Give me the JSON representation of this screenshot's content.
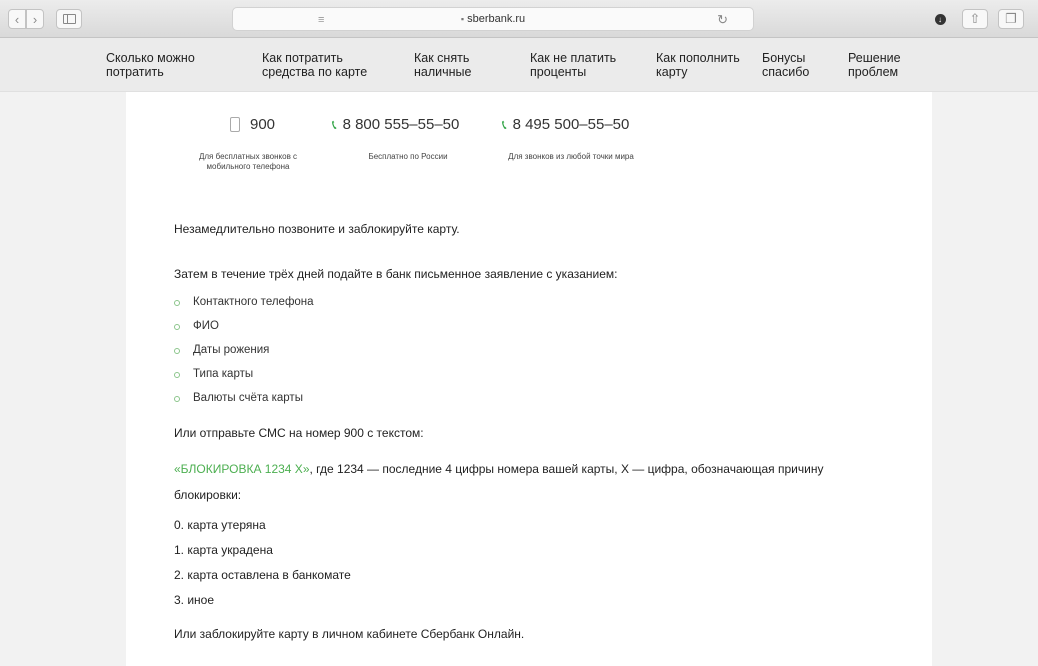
{
  "browser": {
    "url": "sberbank.ru",
    "back_icon": "chevron-left-icon",
    "forward_icon": "chevron-right-icon",
    "sidebar_icon": "sidebar-icon",
    "reader_icon": "reader-lines-icon",
    "lock_icon": "lock-icon",
    "reload_icon": "reload-icon",
    "download_icon": "download-icon",
    "share_icon": "share-icon",
    "tabs_icon": "tabs-icon"
  },
  "nav": {
    "items": [
      {
        "label": "Сколько можно\nпотратить"
      },
      {
        "label": "Как потратить\nсредства по карте"
      },
      {
        "label": "Как снять\nналичные"
      },
      {
        "label": "Как не платить\nпроценты"
      },
      {
        "label": "Как пополнить\nкарту"
      },
      {
        "label": "Бонусы\nспасибо"
      },
      {
        "label": "Решение\nпроблем"
      }
    ]
  },
  "phones": [
    {
      "number": "900",
      "icon": "mobile-phone-icon",
      "caption": "Для бесплатных звонков с\nмобильного телефона"
    },
    {
      "number": "8 800 555–55–50",
      "icon": "phone-icon",
      "caption": "Бесплатно по России"
    },
    {
      "number": "8 495 500–55–50",
      "icon": "phone-icon",
      "caption": "Для звонков из любой точки мира"
    }
  ],
  "content": {
    "p1": "Незамедлительно позвоните и заблокируйте карту.",
    "p2": "Затем в течение трёх дней подайте в банк письменное заявление с указанием:",
    "bullets": [
      "Контактного телефона",
      "ФИО",
      "Даты рожения",
      "Типа карты",
      "Валюты счёта карты"
    ],
    "p3": "Или отправьте СМС на номер 900 с текстом:",
    "sms_code": "«БЛОКИРОВКА 1234 X»",
    "sms_rest": ", где 1234 — последние 4 цифры номера вашей карты, X — цифра, обозначающая причину",
    "sms_rest2": "блокировки:",
    "reasons": [
      "0. карта утеряна",
      "1. карта украдена",
      "2. карта оставлена в банкомате",
      "3. иное"
    ],
    "p4": "Или заблокируйте карту в личном кабинете Сбербанк Онлайн."
  },
  "colors": {
    "accent": "#4caf50",
    "phone_icon": "#2ea343"
  }
}
